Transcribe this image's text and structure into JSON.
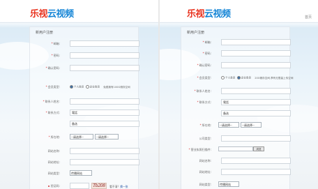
{
  "brand": {
    "logo_part1": "乐视",
    "logo_part2": "云视频",
    "colors": {
      "red": "#e8321e",
      "blue": "#1585d6"
    }
  },
  "right_header": {
    "home_link": "首页"
  },
  "form_title": "新用户注册",
  "fields": {
    "email": "邮箱:",
    "password": "密码:",
    "confirm_password": "确认密码:",
    "member_type": "会员类型:",
    "contact_name": "联系人姓名:",
    "contact_method": "联系方式:",
    "region": "所在地:",
    "website_name": "网站名称:",
    "website_url": "网站地址:",
    "website_type": "网站类型:",
    "captcha": "验证码:",
    "company_type": "公司类型:",
    "business_license": "营业执照扫描件:",
    "company_website_name": "网站名称:",
    "company_website_url": "网站地址:",
    "company_website_type": "网站类型:"
  },
  "member_options": {
    "personal": "个人会员",
    "company": "企业会员",
    "left_hint": "免费拥有100G储存空间",
    "right_hint": "20G储存空间,享有无限量上传空间"
  },
  "contact_values": {
    "mobile": "電話",
    "landline": "备选"
  },
  "region_selects": {
    "province": "--请选择--",
    "city": "--请选择--"
  },
  "website_type_value": "传播网站",
  "captcha": {
    "image_text": "Tb208",
    "refresh_prefix": "看不清？",
    "refresh_link": "换一张"
  },
  "browse_button": "浏览"
}
